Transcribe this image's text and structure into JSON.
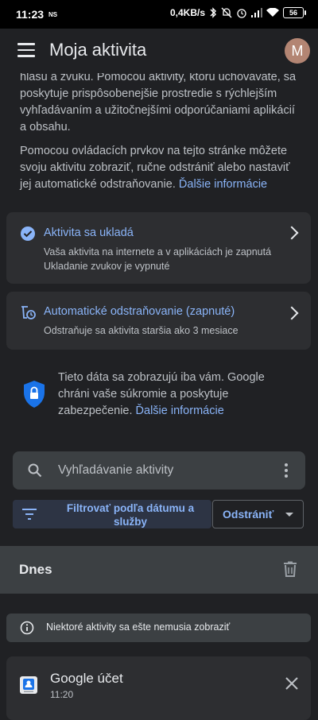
{
  "status_bar": {
    "time": "11:23",
    "ns_badge": "NS",
    "speed": "0,4KB/s",
    "battery": "56"
  },
  "header": {
    "title": "Moja aktivita",
    "avatar_initial": "M"
  },
  "intro": {
    "paragraph1": "hlasu a zvuku. Pomocou aktivity, ktorú uchovávate, sa poskytuje prispôsobenejšie prostredie s rýchlejším vyhľadávaním a užitočnejšími odporúčaniami aplikácií a obsahu.",
    "paragraph2": "Pomocou ovládacích prvkov na tejto stránke môžete svoju aktivitu zobraziť, ručne odstrániť alebo nastaviť jej automatické odstraňovanie.",
    "paragraph2_link": "Ďalšie informácie"
  },
  "cards": [
    {
      "title": "Aktivita sa ukladá",
      "lines": [
        "Vaša aktivita na internete a v aplikáciách je zapnutá",
        "Ukladanie zvukov je vypnuté"
      ],
      "icon": "check-circle-icon"
    },
    {
      "title": "Automatické odstraňovanie (zapnuté)",
      "lines": [
        "Odstraňuje sa aktivita staršia ako 3 mesiace"
      ],
      "icon": "auto-delete-icon"
    }
  ],
  "privacy": {
    "text": "Tieto dáta sa zobrazujú iba vám. Google chráni vaše súkromie a poskytuje zabezpečenie.",
    "link": "Ďalšie informácie"
  },
  "search": {
    "placeholder": "Vyhľadávanie aktivity"
  },
  "filter": {
    "label": "Filtrovať podľa dátumu a služby"
  },
  "delete": {
    "label": "Odstrániť"
  },
  "today": {
    "label": "Dnes"
  },
  "notice": {
    "text": "Niektoré aktivity sa ešte nemusia zobraziť"
  },
  "activity_item": {
    "title": "Google účet",
    "time": "11:20"
  },
  "colors": {
    "background": "#202124",
    "card": "#2d2e31",
    "accent": "#8ab4f8",
    "shield": "#1a73e8"
  }
}
